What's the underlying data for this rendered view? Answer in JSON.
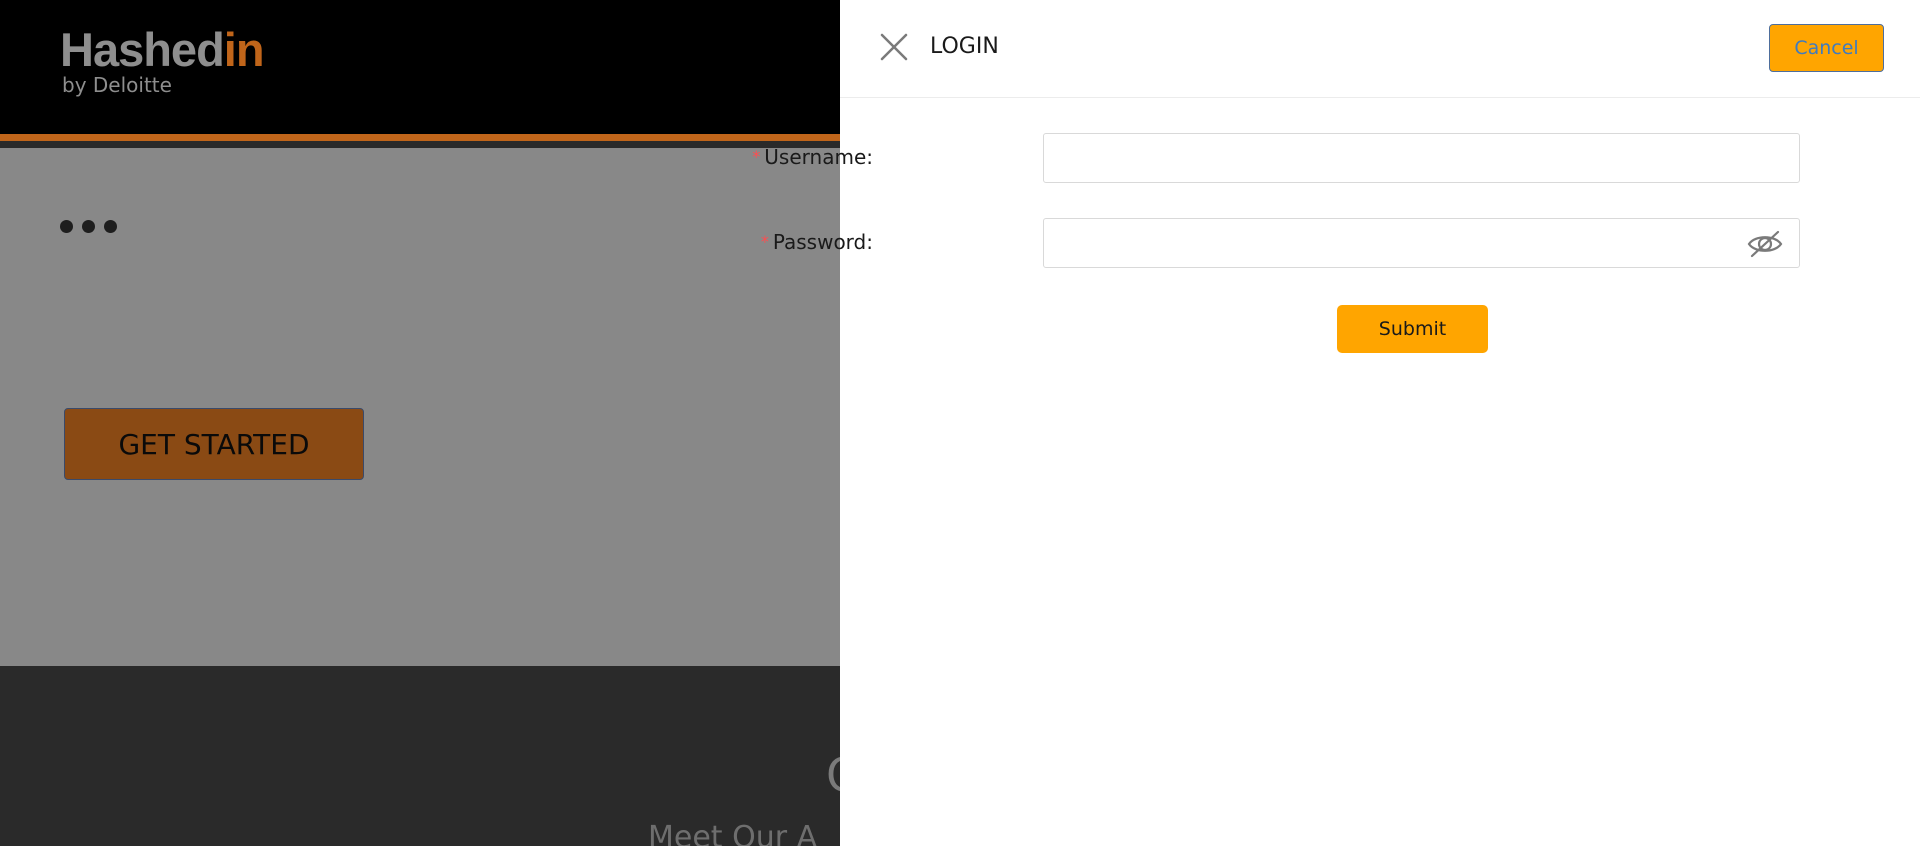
{
  "background": {
    "logo": {
      "main_prefix": "Hashed",
      "main_accent": "in",
      "sub": "by Deloitte"
    },
    "get_started_label": "GET STARTED",
    "footer_heading_fragment": "O",
    "footer_subheading_fragment": "Meet Our A",
    "colors": {
      "header": "#000000",
      "accent": "#c0651a",
      "overlay": "#888888",
      "footer": "#2a2a2a"
    }
  },
  "drawer": {
    "title": "LOGIN",
    "close_icon": "close-icon",
    "cancel_label": "Cancel",
    "form": {
      "username": {
        "label": "Username",
        "required_mark": "*",
        "value": ""
      },
      "password": {
        "label": "Password",
        "required_mark": "*",
        "value": "",
        "toggle_icon": "eye-slash-icon"
      },
      "submit_label": "Submit"
    },
    "colors": {
      "primary": "#ffa500",
      "required": "#ff4d4f",
      "cancel_text": "#3f7bbf"
    }
  }
}
